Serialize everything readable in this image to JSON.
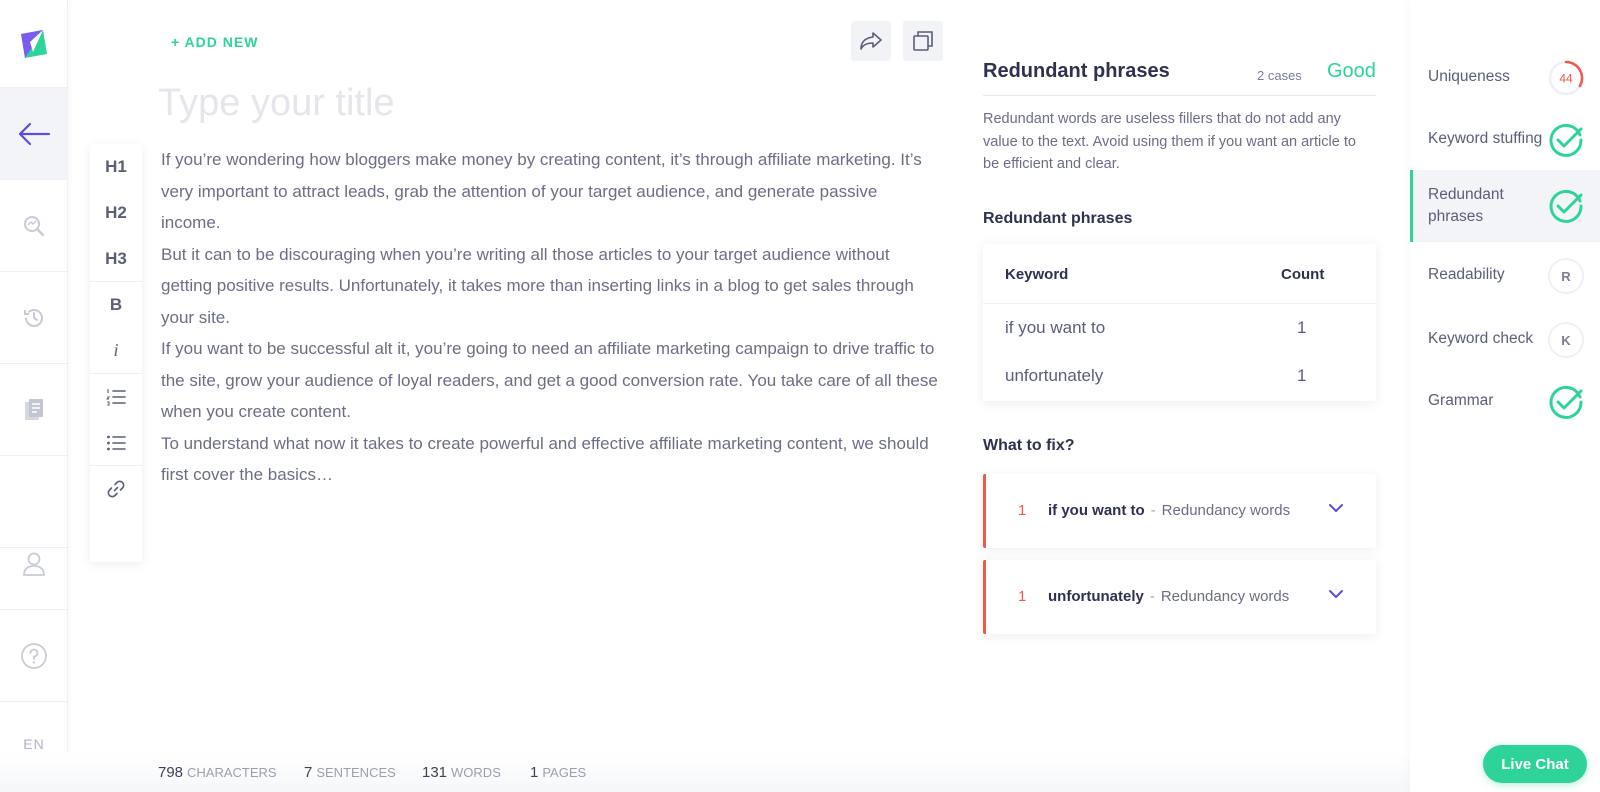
{
  "nav": {
    "language": "EN"
  },
  "toolbar": {
    "add_new": "+ ADD NEW",
    "h1": "H1",
    "h2": "H2",
    "h3": "H3",
    "bold": "B",
    "italic": "i"
  },
  "editor": {
    "title_placeholder": "Type your title",
    "paragraphs": [
      "If you’re wondering how bloggers make money by creating content, it’s through affiliate marketing. It’s very important to attract leads, grab the attention of your target audience, and generate passive income.",
      "But it can to be discouraging when you’re writing all those articles to your target audience without getting positive results. Unfortunately, it takes more than inserting links in a blog to get sales through your site.",
      "If you want to be successful alt it, you’re going to need an affiliate marketing campaign to drive traffic to the site, grow your audience of loyal readers, and get a good conversion rate. You take care of all these when you create content.",
      "To understand what now it takes to create powerful and effective affiliate marketing content, we should first cover the basics…"
    ]
  },
  "stats": {
    "characters": {
      "value": "798",
      "label": "CHARACTERS"
    },
    "sentences": {
      "value": "7",
      "label": "SENTENCES"
    },
    "words": {
      "value": "131",
      "label": "WORDS"
    },
    "pages": {
      "value": "1",
      "label": "PAGES"
    }
  },
  "panel": {
    "title": "Redundant phrases",
    "cases": "2 cases",
    "status": "Good",
    "description": "Redundant words are useless fillers that do not add any value to the text. Avoid using them if you want an article to be efficient and clear.",
    "table_title": "Redundant phrases",
    "table": {
      "col_keyword": "Keyword",
      "col_count": "Count",
      "rows": [
        {
          "keyword": "if you want to",
          "count": "1"
        },
        {
          "keyword": "unfortunately",
          "count": "1"
        }
      ]
    },
    "fix_title": "What to fix?",
    "fixes": [
      {
        "num": "1",
        "word": "if you want to",
        "dash": "-",
        "type": "Redundancy words"
      },
      {
        "num": "1",
        "word": "unfortunately",
        "dash": "-",
        "type": "Redundancy words"
      }
    ]
  },
  "checks": {
    "uniqueness": {
      "label": "Uniqueness",
      "score": "44"
    },
    "keyword_stuffing": {
      "label": "Keyword stuffing"
    },
    "redundant": {
      "label": "Redundant phrases"
    },
    "readability": {
      "label": "Readability",
      "letter": "R"
    },
    "keyword_check": {
      "label": "Keyword check",
      "letter": "K"
    },
    "grammar": {
      "label": "Grammar"
    }
  },
  "live_chat": "Live Chat",
  "colors": {
    "accent_green": "#2ed39a",
    "accent_purple": "#5b4fd6",
    "warning_red": "#f0584a"
  }
}
